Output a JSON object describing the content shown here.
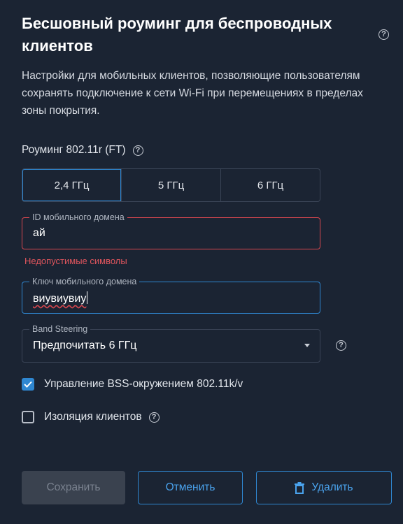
{
  "header": {
    "title": "Бесшовный роуминг для беспроводных клиентов",
    "help_icon": "help-circle-icon"
  },
  "description": "Настройки для мобильных клиентов, позволяющие пользователям сохранять подключение к сети Wi-Fi при перемещениях в пределах зоны покрытия.",
  "roaming": {
    "label": "Роуминг 802.11r (FT)",
    "bands": [
      {
        "label": "2,4 ГГц",
        "selected": true
      },
      {
        "label": "5 ГГц",
        "selected": false
      },
      {
        "label": "6 ГГц",
        "selected": false
      }
    ]
  },
  "mobility_domain_id": {
    "label": "ID мобильного домена",
    "value": "ай",
    "error": "Недопустимые символы"
  },
  "mobility_domain_key": {
    "label": "Ключ мобильного домена",
    "value": "виувиувиу"
  },
  "band_steering": {
    "label": "Band Steering",
    "value": "Предпочитать 6 ГГц"
  },
  "options": {
    "bss": {
      "label": "Управление BSS-окружением 802.11k/v",
      "checked": true
    },
    "isolation": {
      "label": "Изоляция клиентов",
      "checked": false
    }
  },
  "actions": {
    "save": "Сохранить",
    "cancel": "Отменить",
    "delete": "Удалить"
  },
  "colors": {
    "background": "#1b2433",
    "accent": "#2f87d1",
    "error": "#d8474f"
  }
}
